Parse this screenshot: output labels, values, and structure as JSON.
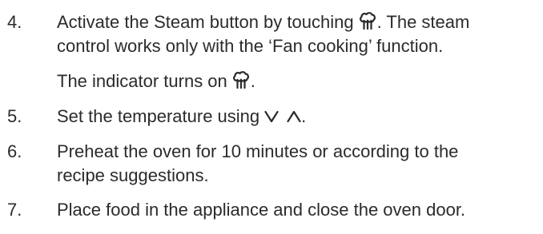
{
  "steps": [
    {
      "number": "4.",
      "line1_pre": "Activate the Steam button by touching",
      "line1_post": ". The steam",
      "line2": "control works only with the ‘Fan cooking’ function.",
      "line3_pre": "The indicator turns on",
      "line3_post": ".",
      "icon": "steam-icon"
    },
    {
      "number": "5.",
      "text_pre": "Set the temperature using",
      "text_post": ".",
      "icons": [
        "chevron-down-icon",
        "chevron-up-icon"
      ]
    },
    {
      "number": "6.",
      "line1": "Preheat the oven for 10 minutes or according to the",
      "line2": "recipe suggestions."
    },
    {
      "number": "7.",
      "line1": "Place food in the appliance and close the oven door."
    }
  ],
  "colors": {
    "text": "#2b2b2b"
  }
}
